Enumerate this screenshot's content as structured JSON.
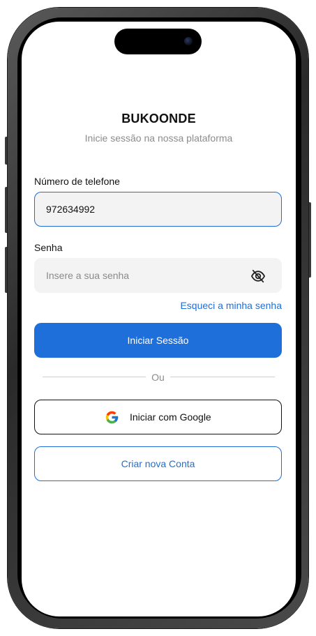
{
  "app": {
    "title": "BUKOONDE",
    "subtitle": "Inicie sessão na nossa plataforma"
  },
  "login_form": {
    "phone_label": "Número de telefone",
    "phone_value": "972634992",
    "password_label": "Senha",
    "password_placeholder": "Insere a sua senha",
    "password_visibility_icon": "eye-off-icon",
    "forgot_password_link": "Esqueci a minha senha",
    "submit_label": "Iniciar Sessão"
  },
  "divider": {
    "text": "Ou"
  },
  "social": {
    "google_label": "Iniciar com Google",
    "google_icon": "google-icon"
  },
  "signup": {
    "create_account_label": "Criar nova Conta"
  },
  "colors": {
    "primary": "#1f6fdb",
    "link": "#1f6fd6",
    "field_background": "#f3f3f3",
    "muted_text": "#8c8c8c"
  }
}
